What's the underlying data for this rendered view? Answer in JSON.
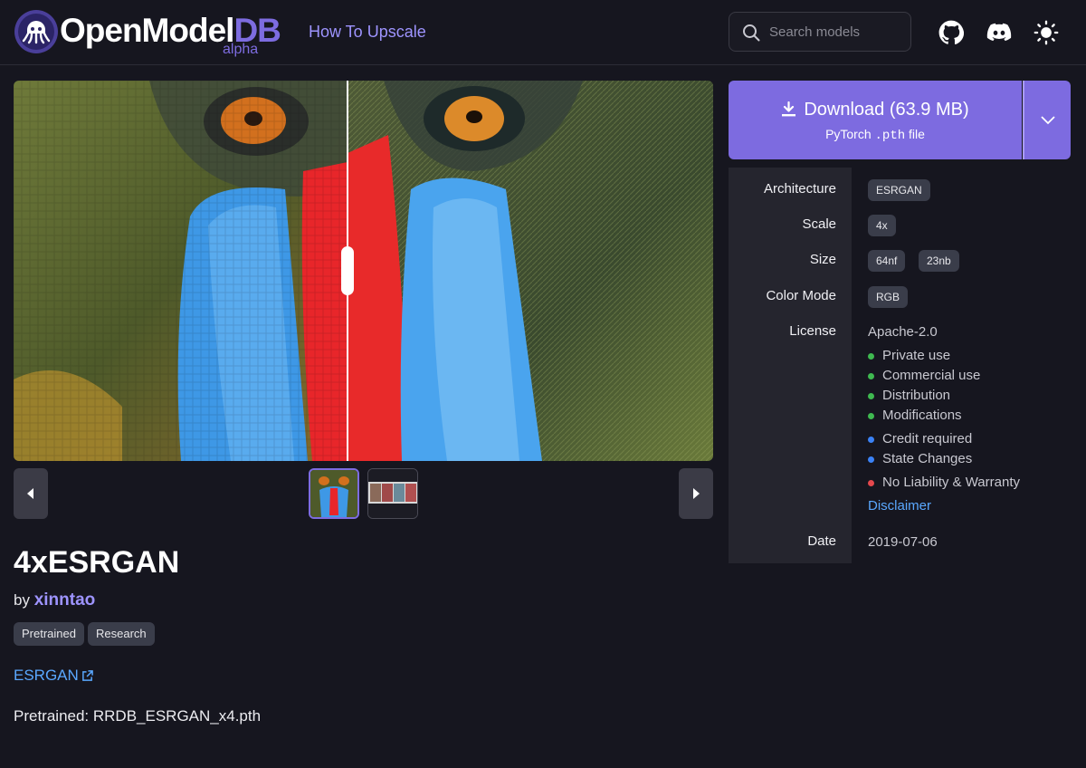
{
  "header": {
    "brand_main": "OpenModel",
    "brand_accent": "DB",
    "brand_badge": "alpha",
    "nav_link": "How To Upscale",
    "search_placeholder": "Search models",
    "icons": [
      "github-icon",
      "discord-icon",
      "sun-icon"
    ]
  },
  "model": {
    "title": "4xESRGAN",
    "by_label": "by",
    "author": "xinntao",
    "tags": [
      "Pretrained",
      "Research"
    ],
    "architecture_link": "ESRGAN",
    "description": "Pretrained: RRDB_ESRGAN_x4.pth"
  },
  "download": {
    "label": "Download (63.9 MB)",
    "format_prefix": "PyTorch",
    "format_ext": ".pth",
    "format_suffix": "file"
  },
  "details": {
    "architecture_label": "Architecture",
    "architecture_value": "ESRGAN",
    "scale_label": "Scale",
    "scale_value": "4x",
    "size_label": "Size",
    "size_values": [
      "64nf",
      "23nb"
    ],
    "color_mode_label": "Color Mode",
    "color_mode_value": "RGB",
    "license_label": "License",
    "license_value": "Apache-2.0",
    "permissions": [
      "Private use",
      "Commercial use",
      "Distribution",
      "Modifications"
    ],
    "conditions": [
      "Credit required",
      "State Changes"
    ],
    "limitations": [
      "No Liability & Warranty"
    ],
    "disclaimer": "Disclaimer",
    "date_label": "Date",
    "date_value": "2019-07-06"
  },
  "colors": {
    "accent": "#7d6be0",
    "link": "#5aa8ff",
    "permission": "#3fb950",
    "condition": "#3b82f6",
    "limitation": "#e5484d"
  },
  "carousel": {
    "active_index": 0,
    "thumbnail_count": 2
  }
}
